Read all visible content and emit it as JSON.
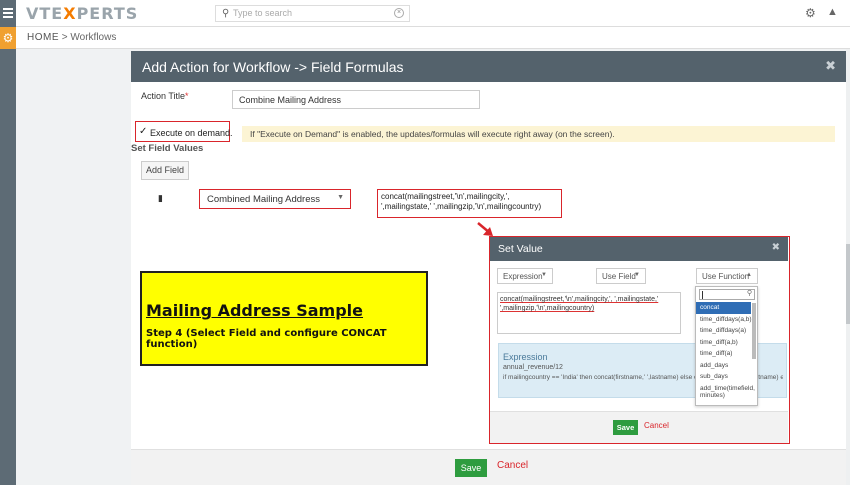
{
  "header": {
    "logo_prefix": "VTE",
    "logo_x": "X",
    "logo_suffix": "PERTS",
    "search_placeholder": "Type to search"
  },
  "breadcrumb": {
    "home": "HOME",
    "separator": " > ",
    "current": "Workflows"
  },
  "modal": {
    "title": "Add Action for Workflow -> Field Formulas",
    "close": "✖",
    "action_title_label": "Action Title",
    "required_mark": "*",
    "action_title_value": "Combine Mailing Address",
    "execute_check": "✓",
    "execute_label": "Execute on demand.",
    "execute_info": "If \"Execute on Demand\" is enabled, the updates/formulas will execute right away (on the screen).",
    "set_field_values": "Set Field Values",
    "add_field": "Add Field",
    "field_select_value": "Combined Mailing Address",
    "formula_value": "concat(mailingstreet,'\\n',mailingcity,', ',mailingstate,' ',mailingzip,'\\n',mailingcountry)",
    "save": "Save",
    "cancel": "Cancel"
  },
  "sample": {
    "title": "Mailing Address Sample",
    "step": "Step 4 (Select Field and configure CONCAT function)"
  },
  "set_value": {
    "title": "Set Value",
    "close": "✖",
    "expression_dd": "Expression",
    "use_field_dd": "Use Field",
    "use_function_dd": "Use Function",
    "expression_text": "concat(mailingstreet,'\\n',mailingcity,', ',mailingstate,' ',mailingzip,'\\n',mailingcountry)",
    "help_heading": "Expression",
    "help_line1": "annual_revenue/12",
    "help_line2": "if mailingcountry == 'India' then concat(firstname,' ',lastname) else concat(lastname,' ',firstname) end",
    "functions": [
      "concat",
      "time_diffdays(a,b)",
      "time_diffdays(a)",
      "time_diff(a,b)",
      "time_diff(a)",
      "add_days",
      "sub_days",
      "add_time(timefield, minutes)"
    ],
    "save": "Save",
    "cancel": "Cancel"
  },
  "colors": {
    "accent_red": "#d9252b",
    "save_green": "#2e9c3f",
    "header_slate": "#54626c",
    "logo_orange": "#f57c00"
  }
}
